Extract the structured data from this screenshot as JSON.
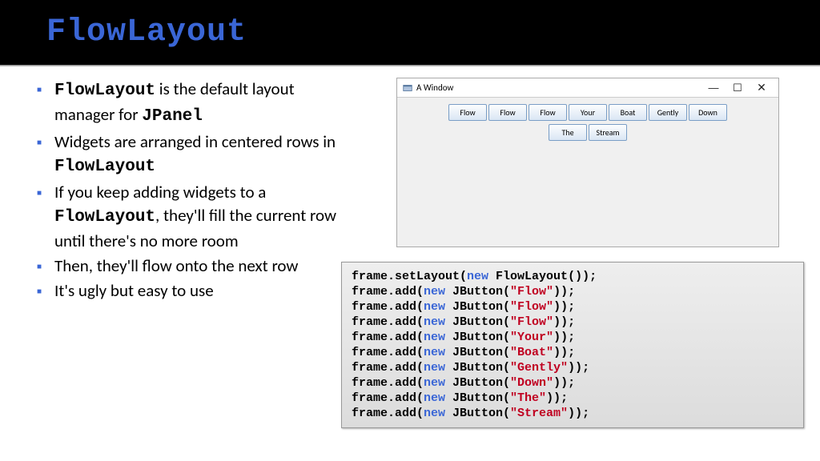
{
  "header": {
    "title": "FlowLayout"
  },
  "bullets": {
    "b1a": "FlowLayout",
    "b1b": " is the default layout manager for ",
    "b1c": "JPanel",
    "b2a": "Widgets are arranged in centered rows in ",
    "b2b": "FlowLayout",
    "b3a": "If you keep adding widgets to a ",
    "b3b": "FlowLayout",
    "b3c": ", they'll fill the current row until there's no more room",
    "b4": "Then, they'll flow onto the next row",
    "b5": "It's ugly but easy to use"
  },
  "window": {
    "title": "A Window",
    "min": "—",
    "max": "☐",
    "close": "✕",
    "buttons": [
      "Flow",
      "Flow",
      "Flow",
      "Your",
      "Boat",
      "Gently",
      "Down",
      "The",
      "Stream"
    ]
  },
  "code": {
    "kw": "new",
    "l1a": "frame.setLayout(",
    "l1b": " FlowLayout());",
    "la": "frame.add(",
    "lb": " JButton(",
    "lc": "));",
    "s1": "\"Flow\"",
    "s2": "\"Flow\"",
    "s3": "\"Flow\"",
    "s4": "\"Your\"",
    "s5": "\"Boat\"",
    "s6": "\"Gently\"",
    "s7": "\"Down\"",
    "s8": "\"The\"",
    "s9": "\"Stream\""
  }
}
